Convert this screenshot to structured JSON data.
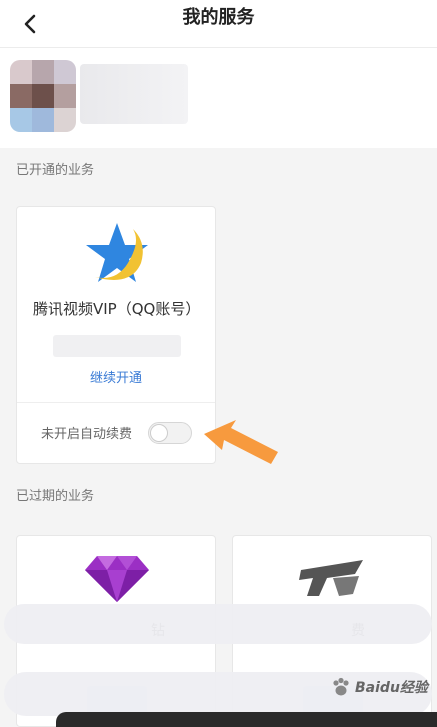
{
  "header": {
    "title": "我的服务"
  },
  "sections": {
    "active_label": "已开通的业务",
    "expired_label": "已过期的业务"
  },
  "active_service": {
    "name": "腾讯视频VIP（QQ账号）",
    "renew_label": "继续开通",
    "autorenew_label": "未开启自动续费",
    "autorenew_on": false
  },
  "expired_services": [
    {
      "icon": "purple-diamond-icon",
      "name_partial": "钻"
    },
    {
      "icon": "gray-logo-icon",
      "name_partial": "费"
    }
  ],
  "colors": {
    "link": "#3a7bd5",
    "arrow": "#f79a3e",
    "star": "#2f86e0",
    "moon": "#f1c232",
    "diamond": "#9b2fc4"
  },
  "watermark": "Baidu经验"
}
